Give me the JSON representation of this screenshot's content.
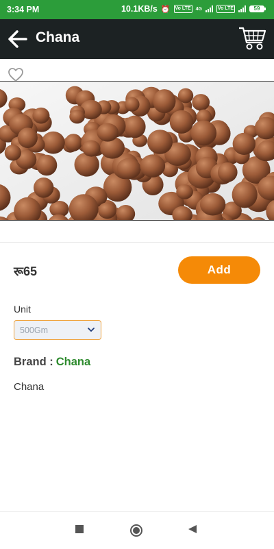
{
  "status": {
    "time": "3:34 PM",
    "speed": "10.1KB/s",
    "badge1": "Vo LTE",
    "badge2": "Vo LTE",
    "net": "4G",
    "battery": "59"
  },
  "appbar": {
    "title": "Chana"
  },
  "product": {
    "price": "रू65",
    "add_label": "Add",
    "unit_label": "Unit",
    "unit_value": "500Gm",
    "brand_label": "Brand :",
    "brand_name": "Chana",
    "description": "Chana"
  },
  "colors": {
    "status_bar": "#2c9d3a",
    "app_bar": "#1c2223",
    "accent": "#f58a07",
    "brand_green": "#2e8b2e"
  },
  "icons": {
    "back": "arrow-left-icon",
    "cart": "cart-icon",
    "favorite": "heart-icon",
    "dropdown": "chevron-down-icon",
    "nav_recent": "square-icon",
    "nav_home": "circle-icon",
    "nav_back": "triangle-back-icon"
  }
}
